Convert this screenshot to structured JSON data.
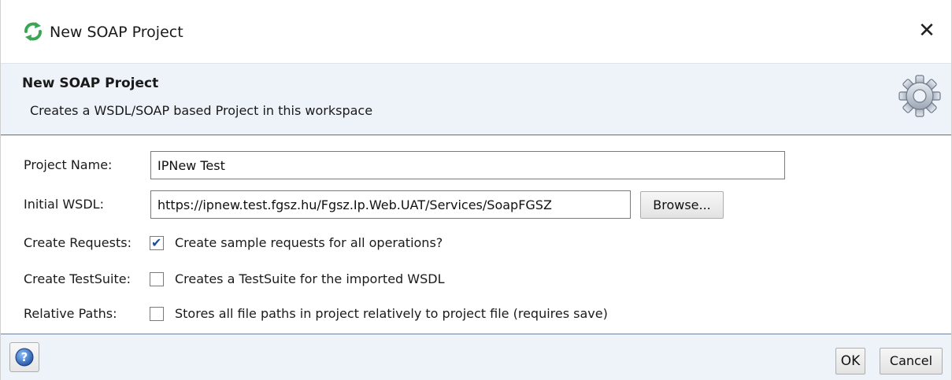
{
  "window": {
    "title": "New SOAP Project",
    "close_glyph": "✕"
  },
  "header": {
    "title": "New SOAP Project",
    "description": "Creates a WSDL/SOAP based Project in this workspace",
    "icon": "gear-icon"
  },
  "form": {
    "project_name": {
      "label": "Project Name:",
      "value": "IPNew Test"
    },
    "initial_wsdl": {
      "label": "Initial WSDL:",
      "value": "https://ipnew.test.fgsz.hu/Fgsz.Ip.Web.UAT/Services/SoapFGSZ",
      "browse_label": "Browse..."
    },
    "create_requests": {
      "label": "Create Requests:",
      "checkbox_label": "Create sample requests for all operations?",
      "checked": true
    },
    "create_testsuite": {
      "label": "Create TestSuite:",
      "checkbox_label": "Creates a TestSuite for the imported WSDL",
      "checked": false
    },
    "relative_paths": {
      "label": "Relative Paths:",
      "checkbox_label": "Stores all file paths in project relatively to project file (requires save)",
      "checked": false
    }
  },
  "footer": {
    "help_icon": "help-icon",
    "ok_label": "OK",
    "cancel_label": "Cancel"
  },
  "colors": {
    "header_bg": "#eef3f9",
    "checkmark": "#1a4fa0",
    "app_icon_green": "#3aa655"
  }
}
